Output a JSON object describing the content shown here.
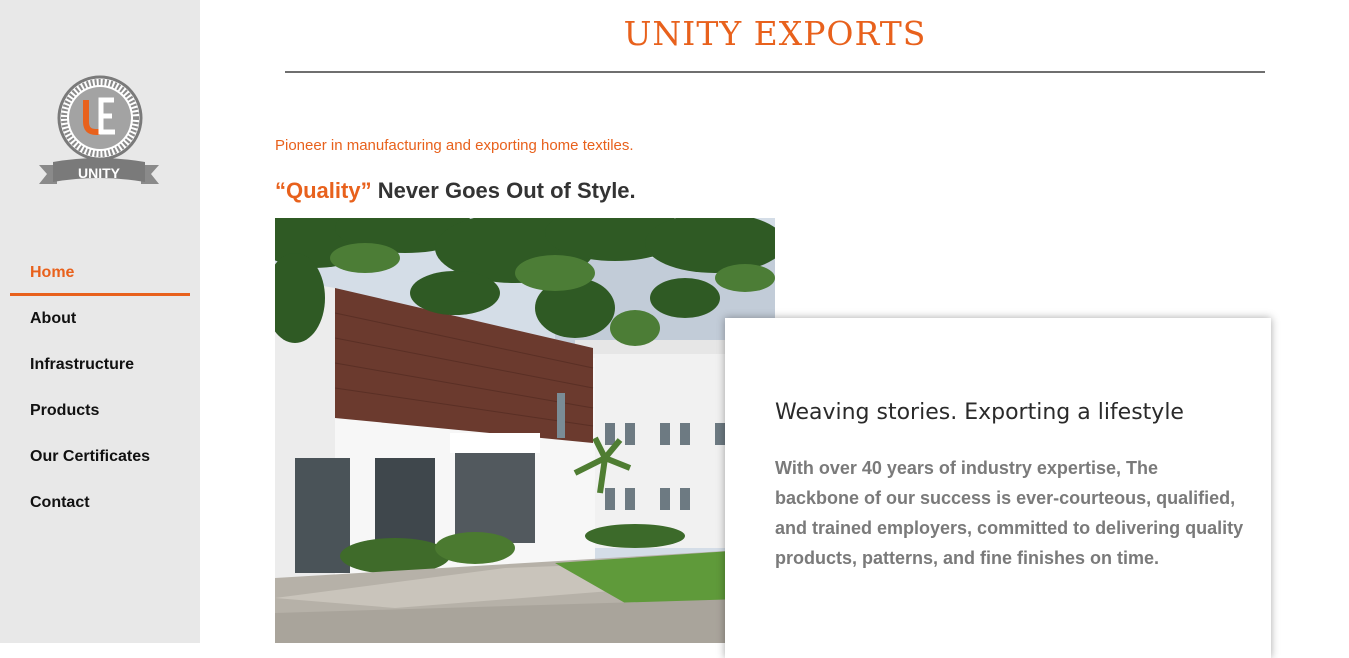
{
  "brand": {
    "logo_monogram": "UE",
    "logo_ribbon_text": "UNITY",
    "site_title": "UNITY EXPORTS",
    "accent_color": "#e8611c"
  },
  "sidebar": {
    "items": [
      {
        "label": "Home",
        "active": true
      },
      {
        "label": "About",
        "active": false
      },
      {
        "label": "Infrastructure",
        "active": false
      },
      {
        "label": "Products",
        "active": false
      },
      {
        "label": "Our Certificates",
        "active": false
      },
      {
        "label": "Contact",
        "active": false
      }
    ]
  },
  "hero": {
    "tagline": "Pioneer in manufacturing and exporting home textiles.",
    "headline_accent": "“Quality”",
    "headline_rest": " Never Goes Out of Style."
  },
  "card": {
    "title": "Weaving stories. Exporting a lifestyle",
    "text": "With over 40 years of industry expertise, The backbone of our success is ever-courteous, qualified, and trained employers, committed to delivering quality products, patterns, and fine finishes on time."
  }
}
